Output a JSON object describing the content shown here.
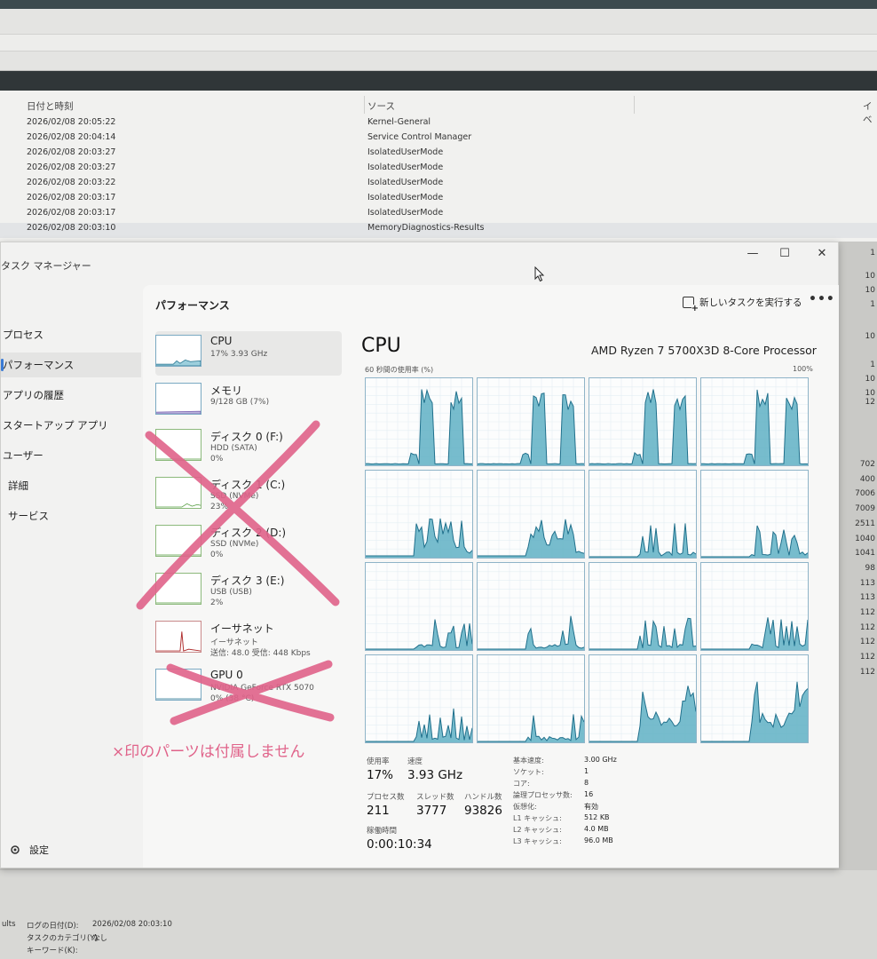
{
  "event_viewer": {
    "col_datetime": "日付と時刻",
    "col_source": "ソース",
    "col_event": "イベ",
    "rows": [
      {
        "date": "2026/02/08 20:05:22",
        "source": "Kernel-General"
      },
      {
        "date": "2026/02/08 20:04:14",
        "source": "Service Control Manager"
      },
      {
        "date": "2026/02/08 20:03:27",
        "source": "IsolatedUserMode"
      },
      {
        "date": "2026/02/08 20:03:27",
        "source": "IsolatedUserMode"
      },
      {
        "date": "2026/02/08 20:03:22",
        "source": "IsolatedUserMode"
      },
      {
        "date": "2026/02/08 20:03:17",
        "source": "IsolatedUserMode"
      },
      {
        "date": "2026/02/08 20:03:17",
        "source": "IsolatedUserMode"
      },
      {
        "date": "2026/02/08 20:03:10",
        "source": "MemoryDiagnostics-Results"
      }
    ],
    "right_values": [
      "1",
      "10",
      "10",
      "1",
      "10",
      "1",
      "10",
      "10",
      "12",
      "702",
      "400",
      "7006",
      "7009",
      "2511",
      "1040",
      "1041",
      "98",
      "113",
      "113",
      "112",
      "112",
      "112",
      "112",
      "112"
    ],
    "bottom": {
      "prefix": "ults",
      "log_date_label": "ログの日付(D):",
      "log_date_value": "2026/02/08 20:03:10",
      "category_label": "タスクのカテゴリ(Y):",
      "category_value": "なし",
      "keyword_label": "キーワード(K):"
    }
  },
  "task_manager": {
    "title": "タスク マネージャー",
    "controls": {
      "minimize": "—",
      "maximize": "☐",
      "close": "✕"
    },
    "nav": [
      "プロセス",
      "パフォーマンス",
      "アプリの履歴",
      "スタートアップ アプリ",
      "ユーザー",
      "詳細",
      "サービス"
    ],
    "settings": "設定",
    "main_title": "パフォーマンス",
    "new_task": "新しいタスクを実行する",
    "more": "•••",
    "resources": [
      {
        "name": "CPU",
        "s1": "17%  3.93 GHz",
        "s2": ""
      },
      {
        "name": "メモリ",
        "s1": "9/128 GB (7%)",
        "s2": ""
      },
      {
        "name": "ディスク 0 (F:)",
        "s1": "HDD (SATA)",
        "s2": "0%"
      },
      {
        "name": "ディスク 1 (C:)",
        "s1": "SSD (NVMe)",
        "s2": "23%"
      },
      {
        "name": "ディスク 2 (D:)",
        "s1": "SSD (NVMe)",
        "s2": "0%"
      },
      {
        "name": "ディスク 3 (E:)",
        "s1": "USB (USB)",
        "s2": "2%"
      },
      {
        "name": "イーサネット",
        "s1": "イーサネット",
        "s2": "送信: 48.0  受信: 448 Kbps"
      },
      {
        "name": "GPU 0",
        "s1": "NVIDIA GeForce RTX 5070",
        "s2": "0% (38 °C)"
      }
    ],
    "cpu": {
      "heading": "CPU",
      "model": "AMD Ryzen 7 5700X3D 8-Core Processor",
      "util_label": "60 秒間の使用率 (%)",
      "util_max": "100%",
      "stats": {
        "util_label": "使用率",
        "util_value": "17%",
        "speed_label": "速度",
        "speed_value": "3.93 GHz",
        "proc_label": "プロセス数",
        "proc_value": "211",
        "thread_label": "スレッド数",
        "thread_value": "3777",
        "handle_label": "ハンドル数",
        "handle_value": "93826",
        "uptime_label": "稼働時間",
        "uptime_value": "0:00:10:34"
      },
      "specs": [
        {
          "label": "基本速度:",
          "value": "3.00 GHz"
        },
        {
          "label": "ソケット:",
          "value": "1"
        },
        {
          "label": "コア:",
          "value": "8"
        },
        {
          "label": "論理プロセッサ数:",
          "value": "16"
        },
        {
          "label": "仮想化:",
          "value": "有効"
        },
        {
          "label": "L1 キャッシュ:",
          "value": "512 KB"
        },
        {
          "label": "L2 キャッシュ:",
          "value": "4.0 MB"
        },
        {
          "label": "L3 キャッシュ:",
          "value": "96.0 MB"
        }
      ]
    }
  },
  "annotation": {
    "note": "×印のパーツは付属しません",
    "color": "#e0638a"
  },
  "colors": {
    "graph_fill": "#5fb0c4",
    "graph_line": "#1f6f8b",
    "accent": "#3a7bd5"
  }
}
